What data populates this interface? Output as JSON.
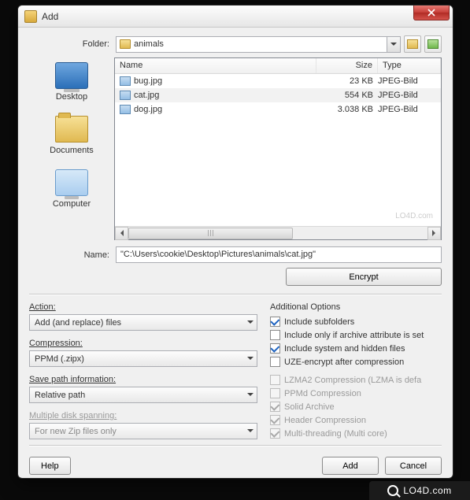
{
  "titlebar": {
    "title": "Add"
  },
  "folder": {
    "label": "Folder:",
    "value": "animals"
  },
  "places": [
    {
      "label": "Desktop",
      "icon": "desktop"
    },
    {
      "label": "Documents",
      "icon": "docs"
    },
    {
      "label": "Computer",
      "icon": "computer"
    }
  ],
  "filelist": {
    "columns": {
      "name": "Name",
      "size": "Size",
      "type": "Type"
    },
    "rows": [
      {
        "name": "bug.jpg",
        "size": "23 KB",
        "type": "JPEG-Bild",
        "selected": false
      },
      {
        "name": "cat.jpg",
        "size": "554 KB",
        "type": "JPEG-Bild",
        "selected": true
      },
      {
        "name": "dog.jpg",
        "size": "3.038 KB",
        "type": "JPEG-Bild",
        "selected": false
      }
    ],
    "watermark": "LO4D.com"
  },
  "nameField": {
    "label": "Name:",
    "value": "\"C:\\Users\\cookie\\Desktop\\Pictures\\animals\\cat.jpg\""
  },
  "encrypt": {
    "label": "Encrypt"
  },
  "left": {
    "action": {
      "label": "Action:",
      "value": "Add (and replace) files"
    },
    "compression": {
      "label": "Compression:",
      "value": "PPMd (.zipx)"
    },
    "savepath": {
      "label": "Save path information:",
      "value": "Relative path"
    },
    "span": {
      "label": "Multiple disk spanning:",
      "value": "For new Zip files only",
      "disabled": true
    }
  },
  "right": {
    "title": "Additional Options",
    "opts": [
      {
        "label": "Include subfolders",
        "checked": true,
        "disabled": false
      },
      {
        "label": "Include only if archive attribute is set",
        "checked": false,
        "disabled": false
      },
      {
        "label": "Include system and hidden files",
        "checked": true,
        "disabled": false
      },
      {
        "label": "UZE-encrypt after compression",
        "checked": false,
        "disabled": false
      },
      {
        "label": "LZMA2 Compression  (LZMA is defa",
        "checked": false,
        "disabled": true
      },
      {
        "label": "PPMd Compression",
        "checked": false,
        "disabled": true
      },
      {
        "label": "Solid Archive",
        "checked": true,
        "disabled": true
      },
      {
        "label": "Header Compression",
        "checked": true,
        "disabled": true
      },
      {
        "label": "Multi-threading (Multi core)",
        "checked": true,
        "disabled": true
      }
    ]
  },
  "footer": {
    "help": "Help",
    "add": "Add",
    "cancel": "Cancel"
  },
  "brand": "LO4D.com"
}
